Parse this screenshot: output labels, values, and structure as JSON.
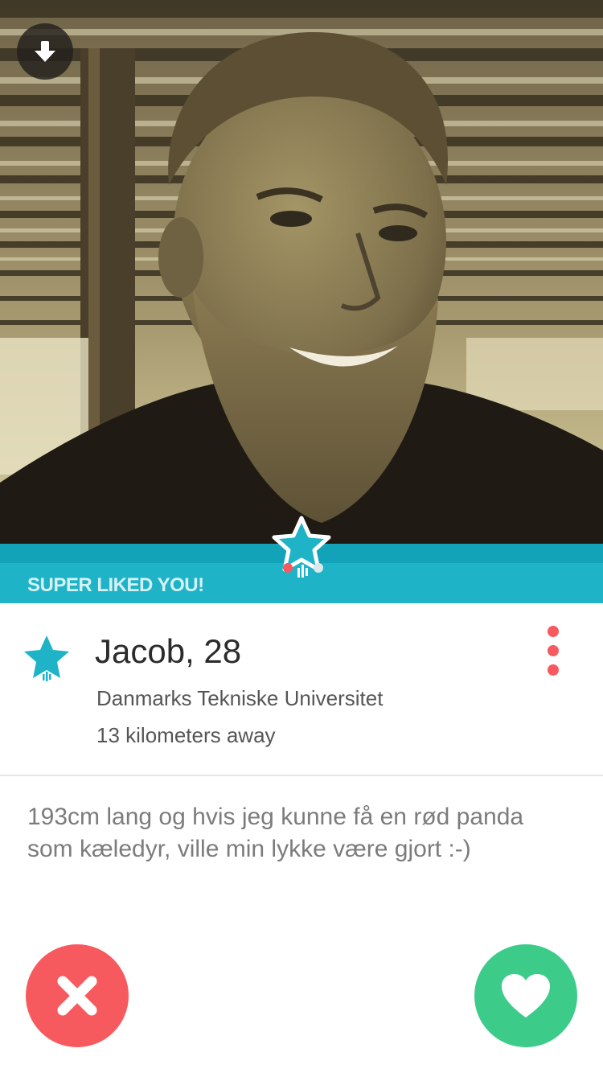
{
  "banner": {
    "label": "SUPER LIKED YOU!"
  },
  "profile": {
    "name": "Jacob, 28",
    "school": "Danmarks Tekniske Universitet",
    "distance": "13 kilometers away",
    "bio_line_1": "193cm lang og hvis jeg kunne få en rød panda",
    "bio_line_2": "som kæledyr, ville min lykke være gjort :-)"
  },
  "icons": {
    "down": "arrow-down-icon",
    "super_like": "super-like-star-icon",
    "more": "more-vertical-icon",
    "nope": "close-x-icon",
    "like": "heart-icon"
  },
  "colors": {
    "super_like_teal": "#1eb3c7",
    "nope_red": "#f65a5e",
    "like_green": "#3dcb8a"
  }
}
